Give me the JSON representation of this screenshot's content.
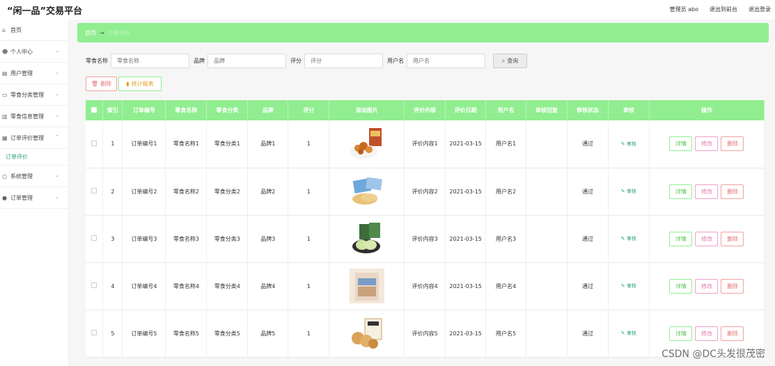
{
  "brand": "“闲一品”交易平台",
  "topnav": [
    "管理员 abo",
    "退出到前台",
    "退出登录"
  ],
  "sidebar": {
    "items": [
      {
        "label": "首页",
        "icon": "home-icon",
        "chev": false
      },
      {
        "label": "个人中心",
        "icon": "user-icon",
        "chev": true
      },
      {
        "label": "用户管理",
        "icon": "users-icon",
        "chev": true
      },
      {
        "label": "零食分类管理",
        "icon": "category-icon",
        "chev": true
      },
      {
        "label": "零食信息管理",
        "icon": "list-icon",
        "chev": true
      },
      {
        "label": "订单评价管理",
        "icon": "comment-icon",
        "chev": true,
        "open": true
      }
    ],
    "submenu": "订单评价",
    "items_after": [
      {
        "label": "系统管理",
        "icon": "settings-icon"
      },
      {
        "label": "订单管理",
        "icon": "location-icon"
      }
    ]
  },
  "breadcrumb": {
    "home": "首页",
    "sep": "→",
    "current": "订单评价"
  },
  "filters": [
    {
      "label": "零食名称",
      "placeholder": "零食名称"
    },
    {
      "label": "品牌",
      "placeholder": "品牌"
    },
    {
      "label": "评分",
      "placeholder": "评分"
    },
    {
      "label": "用户名",
      "placeholder": "用户名"
    }
  ],
  "search_label": "查询",
  "delete_label": "删除",
  "stat_label": "统计报表",
  "table": {
    "headers": [
      "索引",
      "订单编号",
      "零食名称",
      "零食分类",
      "品牌",
      "评分",
      "添加图片",
      "评价内容",
      "评价日期",
      "用户名",
      "审核回复",
      "审核状态",
      "审核",
      "操作"
    ],
    "audit_label": "审核",
    "ops": {
      "detail": "详情",
      "edit": "修改",
      "delete": "删除"
    },
    "rows": [
      {
        "idx": "1",
        "order": "订单编号1",
        "name": "零食名称1",
        "cat": "零食分类1",
        "brand": "品牌1",
        "score": "1",
        "content": "评价内容1",
        "date": "2021-03-15",
        "user": "用户名1",
        "reply": "",
        "status": "通过"
      },
      {
        "idx": "2",
        "order": "订单编号2",
        "name": "零食名称2",
        "cat": "零食分类2",
        "brand": "品牌2",
        "score": "1",
        "content": "评价内容2",
        "date": "2021-03-15",
        "user": "用户名2",
        "reply": "",
        "status": "通过"
      },
      {
        "idx": "3",
        "order": "订单编号3",
        "name": "零食名称3",
        "cat": "零食分类3",
        "brand": "品牌3",
        "score": "1",
        "content": "评价内容3",
        "date": "2021-03-15",
        "user": "用户名3",
        "reply": "",
        "status": "通过"
      },
      {
        "idx": "4",
        "order": "订单编号4",
        "name": "零食名称4",
        "cat": "零食分类4",
        "brand": "品牌4",
        "score": "1",
        "content": "评价内容4",
        "date": "2021-03-15",
        "user": "用户名4",
        "reply": "",
        "status": "通过"
      },
      {
        "idx": "5",
        "order": "订单编号5",
        "name": "零食名称5",
        "cat": "零食分类5",
        "brand": "品牌5",
        "score": "1",
        "content": "评价内容5",
        "date": "2021-03-15",
        "user": "用户名5",
        "reply": "",
        "status": "通过"
      }
    ]
  },
  "watermark": "CSDN @DC头发很茂密"
}
